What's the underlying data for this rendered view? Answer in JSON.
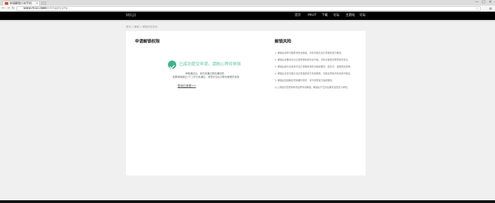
{
  "browser": {
    "tab_title": "申请解锁小米手机",
    "tab_close": "×",
    "url_host": "www.miui.com",
    "url_path": "/unlock/apply.php",
    "win_min": "—",
    "win_max": "□",
    "win_close": "×",
    "back": "←",
    "forward": "→",
    "reload": "↻",
    "star": "☆",
    "menu": "≡"
  },
  "header": {
    "logo": "MIUI",
    "nav": [
      "首页",
      "MIUI7",
      "下载",
      "论坛",
      "主题站",
      "论坛"
    ]
  },
  "breadcrumb": "首页 > 解锁 > 解锁状态查询",
  "left": {
    "title": "申请解锁权限",
    "success_text": "已成功提交申请，请耐心等待审核",
    "note_line1": "审核通过后，我们将通过短信通知您。",
    "note_line2": "如果审核超过7个工作日未通过，请您在论坛中联系管理员咨询",
    "home_link": "登录后查看>>"
  },
  "right": {
    "title": "解锁风险",
    "risks": [
      "1. 解锁后将有可能带来安全隐患，手机可能无法正常使用官方服务。",
      "2. 解锁后设备将无法正常获得系统安全升级，手机可能受到恶意软件攻击。",
      "3. 解锁后部分应用将无法正常使用相关功能或服务，如支付、金融类应用等。",
      "4. 解锁后手机可能无法正常接收官方系统更新，可能会导致手机系统不稳定。",
      "5. 解锁后如因刷机导致硬件损坏，将不享受官方保修服务。",
      "以上风险请您谨慎考虑后再申请解锁，解锁后产生的后果将由您自行承担。"
    ]
  }
}
